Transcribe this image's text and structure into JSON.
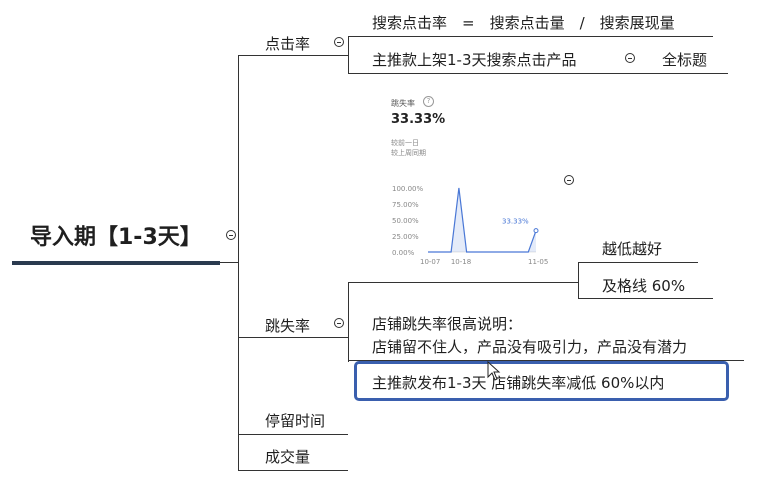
{
  "root": {
    "label": "导入期【1-3天】"
  },
  "branches": {
    "ctr": {
      "label": "点击率"
    },
    "bounce": {
      "label": "跳失率"
    },
    "stay": {
      "label": "停留时间"
    },
    "deal": {
      "label": "成交量"
    }
  },
  "ctr_children": {
    "formula": {
      "text": "搜索点击率　=　搜索点击量　/　搜索展现量"
    },
    "product": {
      "text": "主推款上架1-3天搜索点击产品"
    },
    "title": {
      "text": "全标题"
    }
  },
  "bounce_children": {
    "lower": {
      "text": "越低越好"
    },
    "pass": {
      "text": "及格线  60%"
    },
    "explain_line1": {
      "text": "店铺跳失率很高说明："
    },
    "explain_line2": {
      "text": "店铺留不住人，产品没有吸引力，产品没有潜力"
    },
    "highlight": {
      "text": "主推款发布1-3天  店铺跳失率减低  60%以内"
    }
  },
  "chart_card": {
    "metric_name": "跳失率",
    "metric_value": "33.33%",
    "compare_day": "较前一日",
    "compare_week": "较上周同期",
    "peak_label": "33.33%"
  },
  "chart_data": {
    "type": "line",
    "x": [
      "10-07",
      "10-18",
      "11-05"
    ],
    "yticks": [
      "100.00%",
      "75.00%",
      "50.00%",
      "25.00%",
      "0.00%"
    ],
    "ylim": [
      0,
      100
    ],
    "series": [
      {
        "values": [
          0,
          0,
          0,
          0,
          100,
          0,
          0,
          0,
          0,
          0,
          0,
          0,
          0,
          0,
          33.33
        ]
      }
    ],
    "annotation": "33.33%"
  },
  "colors": {
    "highlight_border": "#3a5fae",
    "line": "#4a78d6",
    "root_underline": "#2a3a4f"
  }
}
